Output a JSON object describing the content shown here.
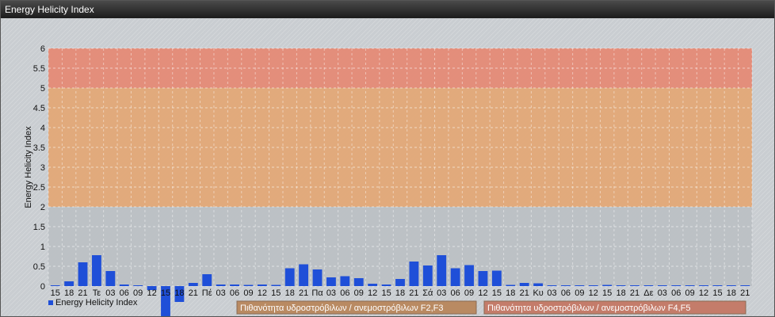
{
  "window": {
    "title": "Energy Helicity Index"
  },
  "chart_data": {
    "type": "bar",
    "title": "",
    "xlabel": "",
    "ylabel": "Energy Helicity Index",
    "ylim": [
      0,
      6
    ],
    "yticks": [
      "0",
      "0.5",
      "1",
      "1.5",
      "2",
      "2.5",
      "3",
      "3.5",
      "4",
      "4.5",
      "5",
      "5.5",
      "6"
    ],
    "grid": true,
    "legend_position": "bottom-left",
    "bands": [
      {
        "from": 0,
        "to": 2,
        "color": "#bcc0c4"
      },
      {
        "from": 2,
        "to": 5,
        "color": "#e3a877"
      },
      {
        "from": 5,
        "to": 6,
        "color": "#e58a76"
      }
    ],
    "band_labels": [
      {
        "text": "Πιθανότητα υδροστρόβιλων / ανεμοστρόβιλων F2,F3",
        "color": "#b98a62"
      },
      {
        "text": "Πιθανότητα υδροστρόβιλων / ανεμοστρόβιλων F4,F5",
        "color": "#c47c6a"
      }
    ],
    "categories": [
      "15",
      "18",
      "21",
      "Τε",
      "03",
      "06",
      "09",
      "12",
      "15",
      "18",
      "21",
      "Πέ",
      "03",
      "06",
      "09",
      "12",
      "15",
      "18",
      "21",
      "Πα",
      "03",
      "06",
      "09",
      "12",
      "15",
      "18",
      "21",
      "Σά",
      "03",
      "06",
      "09",
      "12",
      "15",
      "18",
      "21",
      "Κυ",
      "03",
      "06",
      "09",
      "12",
      "15",
      "18",
      "21",
      "Δε",
      "03",
      "06",
      "09",
      "12",
      "15",
      "18",
      "21"
    ],
    "series": [
      {
        "name": "Energy Helicity Index",
        "color": "#1f4fd8",
        "values": [
          0.02,
          0.12,
          0.6,
          0.78,
          0.38,
          0.04,
          0.02,
          -0.1,
          -0.8,
          -0.4,
          0.08,
          0.3,
          0.04,
          0.04,
          0.03,
          0.04,
          0.03,
          0.45,
          0.55,
          0.42,
          0.22,
          0.25,
          0.2,
          0.06,
          0.04,
          0.18,
          0.62,
          0.52,
          0.78,
          0.45,
          0.53,
          0.38,
          0.39,
          0.03,
          0.08,
          0.07,
          0.02,
          0.02,
          0.02,
          0.02,
          0.03,
          0.02,
          0.02,
          0.02,
          0.02,
          0.02,
          0.02,
          0.02,
          0.02,
          0.02,
          0.02
        ]
      }
    ]
  }
}
